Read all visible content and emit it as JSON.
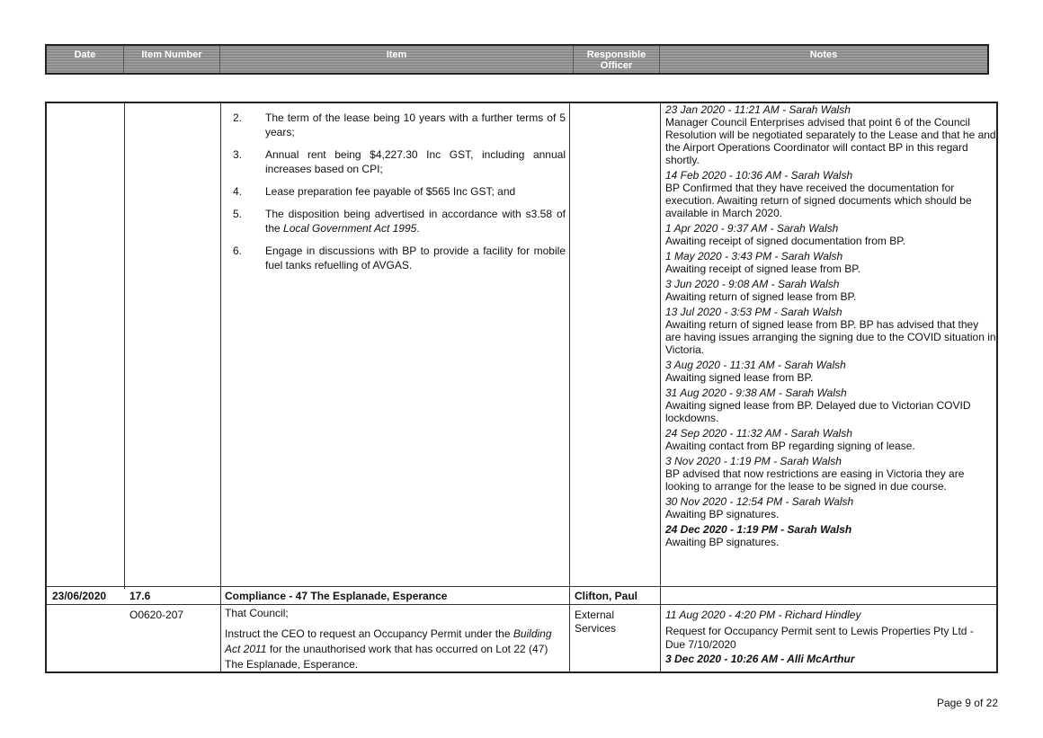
{
  "header": {
    "columns": [
      "Date",
      "Item Number",
      "Item",
      "Responsible Officer",
      "Notes"
    ]
  },
  "item_list": [
    {
      "num": "2.",
      "text": "The term of the lease being 10 years with a further terms of 5 years;"
    },
    {
      "num": "3.",
      "text": "Annual rent being $4,227.30 Inc GST, including annual increases based on CPI;"
    },
    {
      "num": "4.",
      "text": "Lease preparation fee payable of $565 Inc GST; and"
    },
    {
      "num": "5.",
      "text_before": "The disposition being advertised in accordance with s3.58 of the ",
      "text_italic": "Local Government Act 1995",
      "text_after": "."
    },
    {
      "num": "6.",
      "text": "Engage in discussions with BP to provide a facility for mobile fuel tanks refuelling of AVGAS."
    }
  ],
  "notes": [
    {
      "date": "23 Jan 2020 - 11:21 AM - Sarah Walsh",
      "text": "Manager Council Enterprises advised that point 6 of the Council Resolution will be negotiated separately to the Lease and that he and the Airport Operations Coordinator will contact BP in this regard shortly."
    },
    {
      "date": "14 Feb 2020 - 10:36 AM - Sarah Walsh",
      "text": "BP Confirmed that they have received the documentation for execution. Awaiting return of signed documents which should be available in March 2020."
    },
    {
      "date": "1 Apr 2020 - 9:37 AM - Sarah Walsh",
      "text": "Awaiting receipt of signed documentation from BP."
    },
    {
      "date": "1 May 2020 - 3:43 PM - Sarah Walsh",
      "text": "Awaiting receipt of signed lease from BP."
    },
    {
      "date": "3 Jun 2020 - 9:08 AM - Sarah Walsh",
      "text": "Awaiting return of signed lease from BP."
    },
    {
      "date": "13 Jul 2020 - 3:53 PM - Sarah Walsh",
      "text": "Awaiting return of signed lease from BP. BP has advised that they are having issues arranging the signing due to the COVID situation in Victoria."
    },
    {
      "date": "3 Aug 2020 - 11:31 AM - Sarah Walsh",
      "text": "Awaiting signed lease from BP."
    },
    {
      "date": "31 Aug 2020 - 9:38 AM - Sarah Walsh",
      "text": "Awaiting signed lease from BP. Delayed due to Victorian COVID lockdowns."
    },
    {
      "date": "24 Sep 2020 - 11:32 AM - Sarah Walsh",
      "text": "Awaiting contact from BP regarding signing of lease."
    },
    {
      "date": "3 Nov 2020 - 1:19 PM - Sarah Walsh",
      "text": "BP advised that now restrictions are easing in Victoria they are looking to arrange for the lease to be signed in due course."
    },
    {
      "date": "30 Nov 2020 - 12:54 PM - Sarah Walsh",
      "text": "Awaiting BP signatures."
    },
    {
      "date": "24 Dec 2020 - 1:19 PM - Sarah Walsh",
      "bold": true,
      "text": "Awaiting BP signatures."
    }
  ],
  "row2": {
    "date": "23/06/2020",
    "item_number": "17.6",
    "item_title": "Compliance - 47 The Esplanade, Esperance",
    "officer": "Clifton, Paul"
  },
  "row3": {
    "item_number": "O0620-207",
    "officer": "External Services",
    "resolution_intro": "That Council;",
    "resolution_before": "Instruct the CEO to request an Occupancy Permit under the ",
    "resolution_italic": "Building Act 2011",
    "resolution_after": " for the unauthorised work that has occurred on Lot 22 (47) The Esplanade, Esperance.",
    "note1_date": "11 Aug 2020 - 4:20 PM - Richard Hindley",
    "note1_text": "Request for Occupancy Permit sent to Lewis Properties Pty Ltd - Due 7/10/2020",
    "note2_date": "3 Dec 2020 - 10:26 AM - Alli McArthur"
  },
  "footer": {
    "page": "Page 9 of 22"
  }
}
